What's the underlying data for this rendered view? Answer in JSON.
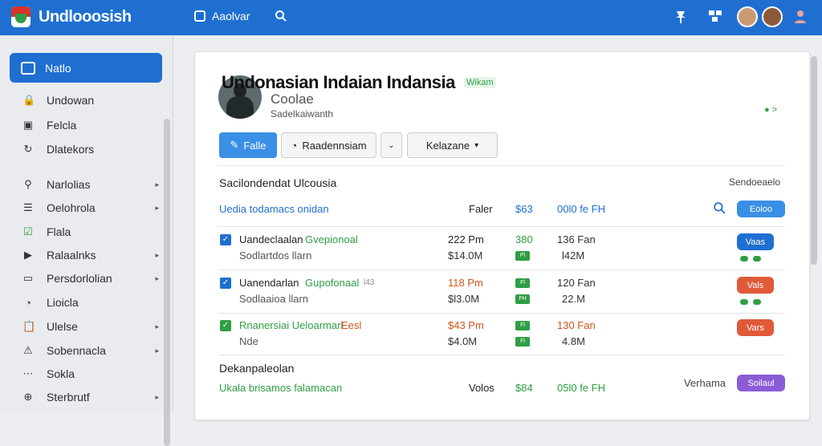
{
  "app": {
    "title": "Undlooosish",
    "nav_button": "Aaolvar"
  },
  "colors": {
    "primary": "#1f6fd1",
    "green": "#2f9e44",
    "red": "#e05a3a",
    "purple": "#8a5cd6"
  },
  "sidebar": {
    "active": "Natlo",
    "items": [
      {
        "label": "Undowan",
        "icon": "lock-icon"
      },
      {
        "label": "Felcla",
        "icon": "square-icon"
      },
      {
        "label": "Dlatekors",
        "icon": "refresh-icon"
      },
      {
        "label": "Narlolias",
        "icon": "search-icon",
        "chevron": "▸"
      },
      {
        "label": "Oelohrola",
        "icon": "list-icon",
        "chevron": "▸"
      },
      {
        "label": "Flala",
        "icon": "check-icon"
      },
      {
        "label": "Ralaalnks",
        "icon": "play-icon",
        "chevron": "▸"
      },
      {
        "label": "Persdorlolian",
        "icon": "window-icon",
        "chevron": "▸"
      },
      {
        "label": "Lioicla",
        "icon": "clock-icon"
      },
      {
        "label": "Ulelse",
        "icon": "clipboard-icon",
        "chevron": "▸"
      },
      {
        "label": "Sobennacla",
        "icon": "triangle-icon",
        "chevron": "▸"
      },
      {
        "label": "Sokla",
        "icon": "dots-icon"
      },
      {
        "label": "Sterbrutf",
        "icon": "globe-icon",
        "chevron": "▸"
      }
    ]
  },
  "profile": {
    "title": "Undonasian Indaian Indansia",
    "tag": "Wikam",
    "subtitle": "Coolae",
    "meta": "Sadelkaiwanth",
    "status": "●  >"
  },
  "toolbar": {
    "primary": "Falle",
    "secondary": "Raadennsiam",
    "dropdown": "Kelazane"
  },
  "section1": {
    "title": "Sacilondendat Ulcousia",
    "right_label": "Sendoeaelo",
    "header": {
      "name": "Uedia todamacs onidan",
      "col1": "Faler",
      "col2": "$63",
      "col3": "00l0 fe FH",
      "button": "Eoioo"
    },
    "rows": [
      {
        "name": "Uandeclaalan",
        "name_accent": "Gvepionoal",
        "sub": "Sodlartdos llarn",
        "val1": "222 Pm",
        "val1b": "$14.0M",
        "val2": "380",
        "val2b": "Pl",
        "val3": "136 Fan",
        "val3b": "l42M",
        "status": "Vaas",
        "status_color": "#1f6fd1",
        "checked": "✓"
      },
      {
        "name": "Uanendarlan",
        "name_accent": "Gupofonaal",
        "name_extra": "l43",
        "sub": "Sodlaaioa llarn",
        "val1": "118 Pm",
        "val1b": "$l3.0M",
        "val2": "Fl",
        "val2b": "FH",
        "val3": "120 Fan",
        "val3b": "22.M",
        "status": "Vals",
        "status_color": "#e05a3a",
        "checked": "✓"
      },
      {
        "name": "Rnanersiai Ueloarmarl",
        "name_accent": "Eesl",
        "sub": "Nde",
        "val1": "$43 Pm",
        "val1b": "$4.0M",
        "val2": "Fl",
        "val2b": "Fl",
        "val3": "130 Fan",
        "val3b": "4.8M",
        "status": "Vars",
        "status_color": "#e05a3a",
        "checked": "✓"
      }
    ]
  },
  "section2": {
    "title": "Dekanpaleolan",
    "footer": {
      "name": "Ukala brisamos falamacan",
      "col1": "Volos",
      "col2": "$84",
      "col3": "05l0 fe FH",
      "right_label": "Verhama",
      "button": "Soilaul"
    }
  }
}
